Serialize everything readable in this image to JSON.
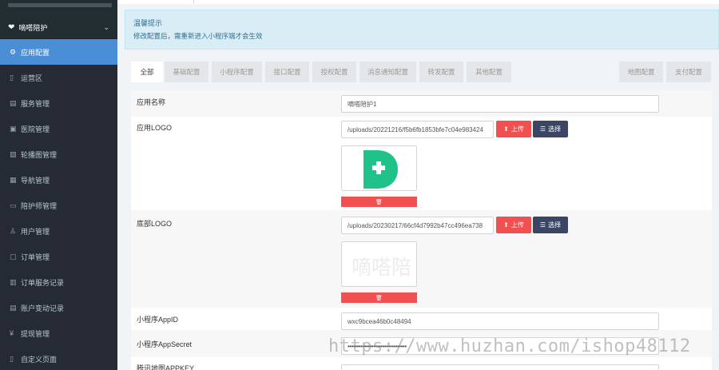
{
  "sidebar": {
    "header": {
      "title": "嘀嗒陪护",
      "icon": "heart-icon",
      "toggle_icon": "chevron-down-icon"
    },
    "items": [
      {
        "label": "应用配置",
        "icon": "gear-icon",
        "active": true
      },
      {
        "label": "运营区",
        "icon": "map-icon"
      },
      {
        "label": "服务管理",
        "icon": "list-icon"
      },
      {
        "label": "医院管理",
        "icon": "hospital-icon"
      },
      {
        "label": "轮播图管理",
        "icon": "image-icon"
      },
      {
        "label": "导航管理",
        "icon": "grid-icon"
      },
      {
        "label": "陪护师管理",
        "icon": "card-icon"
      },
      {
        "label": "用户管理",
        "icon": "user-icon"
      },
      {
        "label": "订单管理",
        "icon": "order-icon"
      },
      {
        "label": "订单服务记录",
        "icon": "record-icon"
      },
      {
        "label": "账户变动记录",
        "icon": "account-icon"
      },
      {
        "label": "提现管理",
        "icon": "yen-icon"
      },
      {
        "label": "自定义页面",
        "icon": "page-icon"
      }
    ]
  },
  "notice": {
    "title": "温馨提示",
    "text": "修改配置后，需重新进入小程序端才会生效"
  },
  "tabs": [
    {
      "label": "全部",
      "active": true
    },
    {
      "label": "基础配置"
    },
    {
      "label": "小程序配置"
    },
    {
      "label": "接口配置"
    },
    {
      "label": "授权配置"
    },
    {
      "label": "消息通知配置"
    },
    {
      "label": "转发配置"
    },
    {
      "label": "其他配置"
    },
    {
      "label": "地图配置"
    },
    {
      "label": "支付配置"
    }
  ],
  "form": {
    "app_name": {
      "label": "应用名称",
      "value": "嘀嗒陪护1"
    },
    "app_logo": {
      "label": "应用LOGO",
      "value": "/uploads/20221216/f5b6fb1853bfe7c04e983424"
    },
    "bottom_logo": {
      "label": "底部LOGO",
      "value": "/uploads/20230217/66cf4d7992b47cc496ea738"
    },
    "appid": {
      "label": "小程序AppID",
      "value": "wxc9bcea46b0c48494"
    },
    "appsecret": {
      "label": "小程序AppSecret",
      "value": "••••••••••••••••••••••••••••••••"
    },
    "map_key": {
      "label": "腾讯地图APPKEY"
    },
    "upload_label": "上传",
    "choose_label": "选择",
    "upload_icon": "upload-icon",
    "choose_icon": "list-icon",
    "delete_icon": "trash-icon",
    "bottom_logo_text": "嘀嗒陪"
  },
  "watermark": "https://www.huzhan.com/ishop48112",
  "colors": {
    "sidebar": "#252a34",
    "active": "#4a8fd6",
    "danger": "#f05050",
    "dark_button": "#3a4663",
    "notice_bg": "#d9edf7",
    "logo_green": "#1fc38a"
  }
}
